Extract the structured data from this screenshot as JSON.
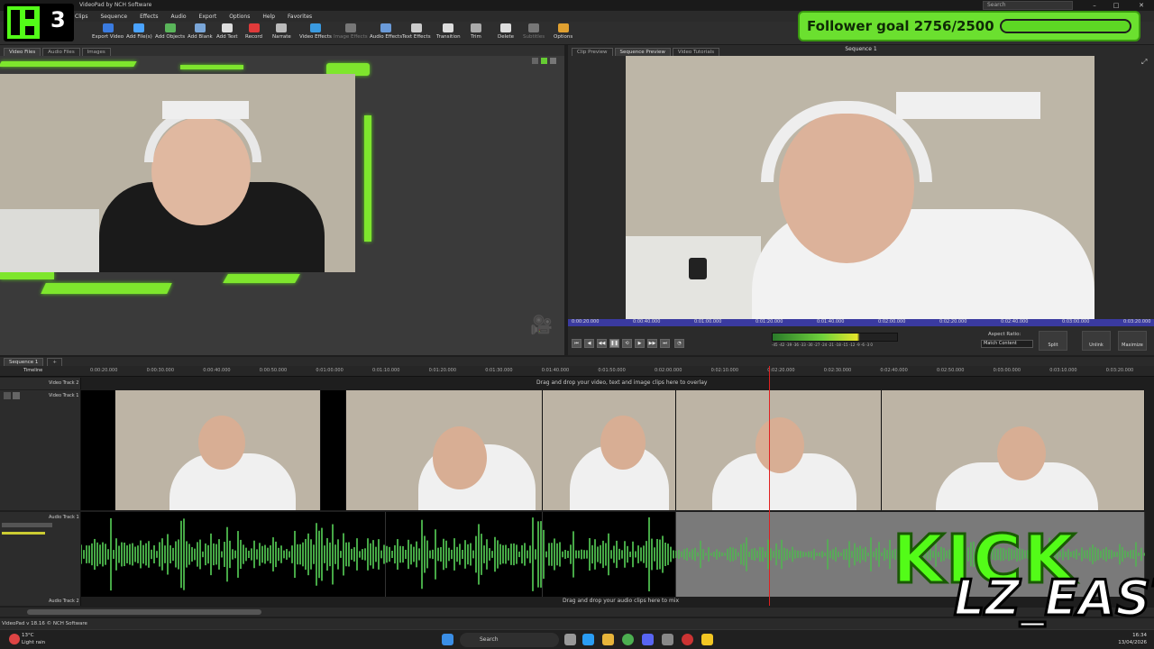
{
  "window": {
    "title": "VideoPad by NCH Software",
    "search_placeholder": "Search"
  },
  "menu": [
    "Clips",
    "Sequence",
    "Effects",
    "Audio",
    "Export",
    "Options",
    "Help",
    "Favorites"
  ],
  "toolbar": [
    {
      "label": "Export Video"
    },
    {
      "label": "Add File(s)"
    },
    {
      "label": "Add Objects"
    },
    {
      "label": "Add Blank"
    },
    {
      "label": "Add Text"
    },
    {
      "label": "Record"
    },
    {
      "label": "Narrate"
    },
    {
      "label": "Video Effects"
    },
    {
      "label": "Image Effects"
    },
    {
      "label": "Audio Effects"
    },
    {
      "label": "Text Effects"
    },
    {
      "label": "Transition"
    },
    {
      "label": "Trim"
    },
    {
      "label": "Delete"
    },
    {
      "label": "Subtitles"
    },
    {
      "label": "Options"
    }
  ],
  "bin_tabs": [
    "Video Files",
    "Audio Files",
    "Images"
  ],
  "preview_tabs": [
    "Clip Preview",
    "Sequence Preview",
    "Video Tutorials"
  ],
  "preview_title": "Sequence 1",
  "scrub_times": [
    "0:00:20.000",
    "0:00:40.000",
    "0:01:00.000",
    "0:01:20.000",
    "0:01:40.000",
    "0:02:00.000",
    "0:02:20.000",
    "0:02:40.000",
    "0:03:00.000",
    "0:03:20.000"
  ],
  "vu_scale": "-45 -42 -39 -36 -33 -30 -27 -24 -21 -18 -15 -12 -9 -6 -3 0",
  "aspect": {
    "label": "Aspect Ratio:",
    "value": "Match Content"
  },
  "side_buttons": [
    "Split",
    "Unlink",
    "Maximize"
  ],
  "sequence_tab": "Sequence 1",
  "timeline_label": "Timeline",
  "ruler": [
    "0:00:20.000",
    "0:00:30.000",
    "0:00:40.000",
    "0:00:50.000",
    "0:01:00.000",
    "0:01:10.000",
    "0:01:20.000",
    "0:01:30.000",
    "0:01:40.000",
    "0:01:50.000",
    "0:02:00.000",
    "0:02:10.000",
    "0:02:20.000",
    "0:02:30.000",
    "0:02:40.000",
    "0:02:50.000",
    "0:03:00.000",
    "0:03:10.000",
    "0:03:20.000"
  ],
  "tracks": {
    "video2": "Video Track 2",
    "video1": "Video Track 1",
    "audio1": "Audio Track 1",
    "audio2": "Audio Track 2"
  },
  "drop_video": "Drag and drop your video, text and image clips here to overlay",
  "drop_audio": "Drag and drop your audio clips here to mix",
  "status": "VideoPad v 18.16 © NCH Software",
  "taskbar": {
    "search": "Search",
    "weather_temp": "13°C",
    "weather_desc": "Light rain",
    "time": "16:34",
    "date": "13/04/2026"
  },
  "stream": {
    "logo_number": "3",
    "follower_text": "Follower goal 2756/2500",
    "follower_progress": 1.0,
    "kick_text": "KICK",
    "channel": "LZ_EAST",
    "accent": "#53fc18"
  }
}
